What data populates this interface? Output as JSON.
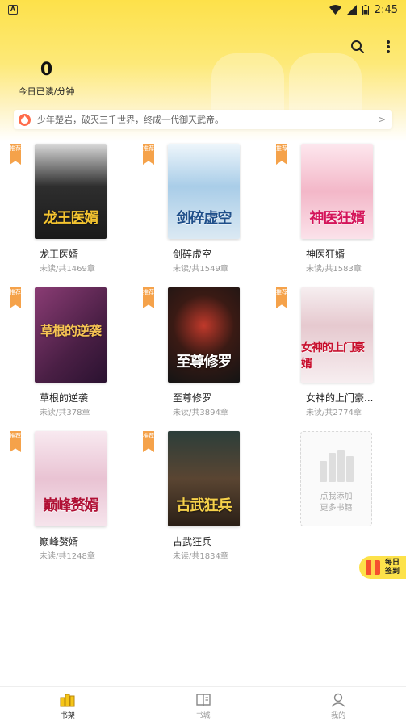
{
  "status_bar": {
    "time": "2:45"
  },
  "header": {
    "reading_minutes": "0",
    "reading_label": "今日已读/分钟"
  },
  "notice": {
    "text": "少年楚岩，破灭三千世界，终成一代御天武帝。",
    "arrow": ">"
  },
  "badge_text": "推荐",
  "books": [
    {
      "title": "龙王医婿",
      "meta": "未读/共1469章",
      "cover_text": "龙王医婿",
      "cover_color": "#3a3a3a",
      "cover_text_color": "#f4c430"
    },
    {
      "title": "剑碎虚空",
      "meta": "未读/共1549章",
      "cover_text": "剑碎虚空",
      "cover_color": "#b9d8ee",
      "cover_text_color": "#1f4f8a"
    },
    {
      "title": "神医狂婿",
      "meta": "未读/共1583章",
      "cover_text": "神医狂婿",
      "cover_color": "#f7c9d4",
      "cover_text_color": "#d4145a"
    },
    {
      "title": "草根的逆袭",
      "meta": "未读/共378章",
      "cover_text": "草根的逆袭",
      "cover_color": "#6b2d5c",
      "cover_text_color": "#f6c453"
    },
    {
      "title": "至尊修罗",
      "meta": "未读/共3894章",
      "cover_text": "至尊修罗",
      "cover_color": "#2b2b2b",
      "cover_text_color": "#ffffff"
    },
    {
      "title": "女神的上门豪...",
      "meta": "未读/共2774章",
      "cover_text": "女神的上门豪婿",
      "cover_color": "#f2e6e8",
      "cover_text_color": "#c8102e"
    },
    {
      "title": "巅峰赘婿",
      "meta": "未读/共1248章",
      "cover_text": "巅峰赘婿",
      "cover_color": "#f4dde8",
      "cover_text_color": "#b01035"
    },
    {
      "title": "古武狂兵",
      "meta": "未读/共1834章",
      "cover_text": "古武狂兵",
      "cover_color": "#4b3a2a",
      "cover_text_color": "#f6d14a"
    }
  ],
  "add_card": {
    "line1": "点我添加",
    "line2": "更多书籍"
  },
  "signin": {
    "line1": "每日",
    "line2": "签到"
  },
  "tabs": [
    {
      "label": "书架",
      "icon": "bookshelf-icon",
      "active": true
    },
    {
      "label": "书城",
      "icon": "bookstore-icon",
      "active": false
    },
    {
      "label": "我的",
      "icon": "profile-icon",
      "active": false
    }
  ],
  "colors": {
    "accent": "#fde24a",
    "badge": "#f5a24a"
  }
}
